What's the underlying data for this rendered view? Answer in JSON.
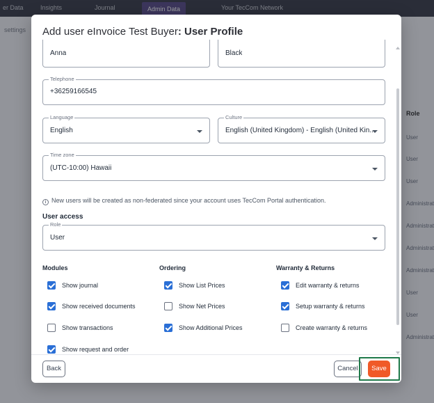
{
  "background": {
    "nav": [
      "er Data",
      "Insights",
      "Journal",
      "Admin Data",
      "Your TecCom Network"
    ],
    "subtitle": "settings",
    "table_header": "Role",
    "table_cells": [
      "User",
      "User",
      "User",
      "Administrator",
      "Administrator",
      "Administrator",
      "Administrator",
      "User",
      "User",
      "Administrator"
    ]
  },
  "modal": {
    "title_prefix": "Add user eInvoice Test Buyer",
    "title_suffix": ": User Profile",
    "first_name": {
      "value": "Anna"
    },
    "last_name": {
      "value": "Black"
    },
    "telephone": {
      "label": "Telephone",
      "value": "+36259166545"
    },
    "language": {
      "label": "Language",
      "value": "English"
    },
    "culture": {
      "label": "Culture",
      "value": "English (United Kingdom) - English (United Kin..."
    },
    "timezone": {
      "label": "Time zone",
      "value": "(UTC-10:00) Hawaii"
    },
    "info_text": "New users will be created as non-federated since your account uses TecCom Portal authentication.",
    "info_icon": "i",
    "user_access_title": "User access",
    "role": {
      "label": "Role",
      "value": "User"
    },
    "modules": {
      "title": "Modules",
      "items": [
        {
          "label": "Show journal",
          "checked": true
        },
        {
          "label": "Show received documents",
          "checked": true
        },
        {
          "label": "Show transactions",
          "checked": false
        },
        {
          "label": "Show request and order",
          "checked": true
        }
      ]
    },
    "ordering": {
      "title": "Ordering",
      "items": [
        {
          "label": "Show List Prices",
          "checked": true
        },
        {
          "label": "Show Net Prices",
          "checked": false
        },
        {
          "label": "Show Additional Prices",
          "checked": true
        }
      ]
    },
    "warranty": {
      "title": "Warranty & Returns",
      "items": [
        {
          "label": "Edit warranty & returns",
          "checked": true
        },
        {
          "label": "Setup warranty & returns",
          "checked": true
        },
        {
          "label": "Create warranty & returns",
          "checked": false
        }
      ]
    },
    "buttons": {
      "back": "Back",
      "cancel": "Cancel",
      "save": "Save"
    }
  },
  "colors": {
    "accent_save": "#f05a28",
    "checkbox_checked": "#2a6fd6",
    "highlight_box": "#1f7a4a"
  }
}
